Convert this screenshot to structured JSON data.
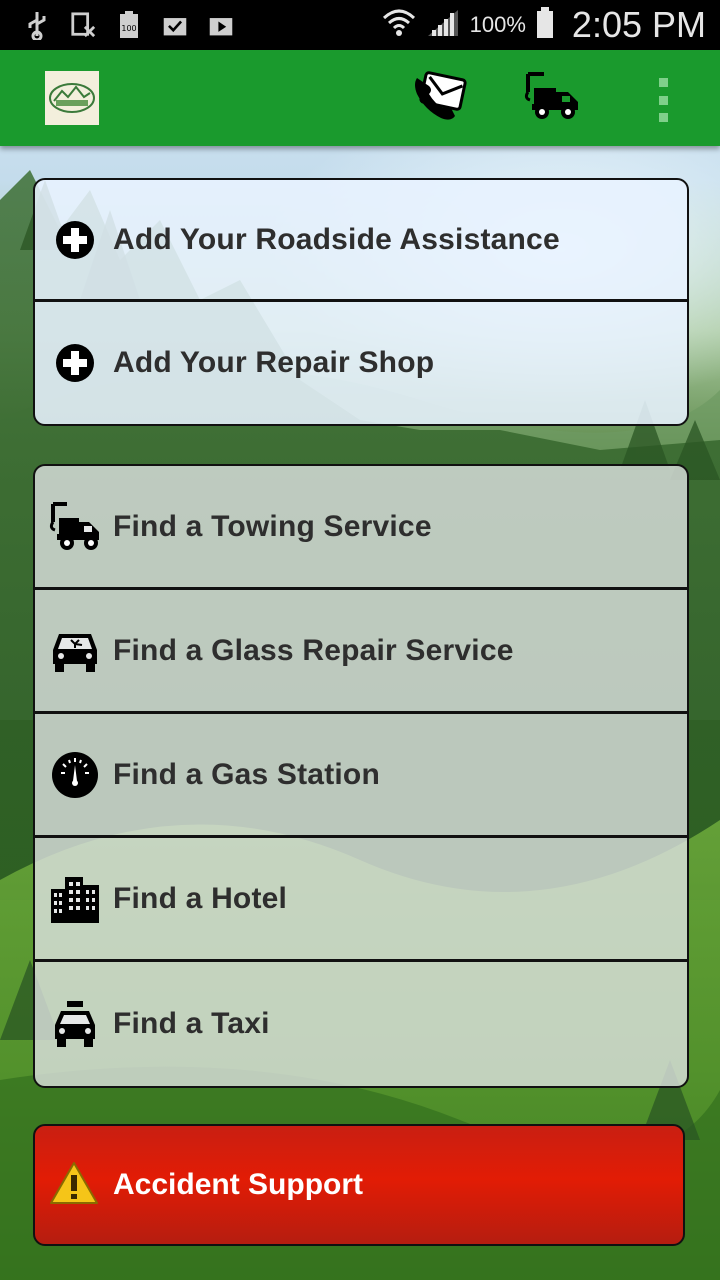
{
  "status_bar": {
    "battery_percent": "100%",
    "time": "2:05 PM"
  },
  "app_bar": {
    "logo": "app-logo",
    "actions": [
      {
        "icon": "phone-call-icon"
      },
      {
        "icon": "tow-truck-icon"
      },
      {
        "icon": "overflow-menu-icon"
      }
    ],
    "accent_color": "#1a9a2d"
  },
  "add_section": {
    "items": [
      {
        "label": "Add Your Roadside Assistance",
        "icon": "add-circle-icon"
      },
      {
        "label": "Add Your Repair Shop",
        "icon": "add-circle-icon"
      }
    ]
  },
  "find_section": {
    "items": [
      {
        "label": "Find a Towing Service",
        "icon": "tow-truck-icon"
      },
      {
        "label": "Find a Glass Repair Service",
        "icon": "broken-glass-car-icon"
      },
      {
        "label": "Find a Gas Station",
        "icon": "fuel-gauge-icon"
      },
      {
        "label": "Find a Hotel",
        "icon": "buildings-icon"
      },
      {
        "label": "Find a Taxi",
        "icon": "taxi-icon"
      }
    ]
  },
  "accident": {
    "label": "Accident Support",
    "icon": "warning-icon",
    "color": "#e21c05"
  }
}
